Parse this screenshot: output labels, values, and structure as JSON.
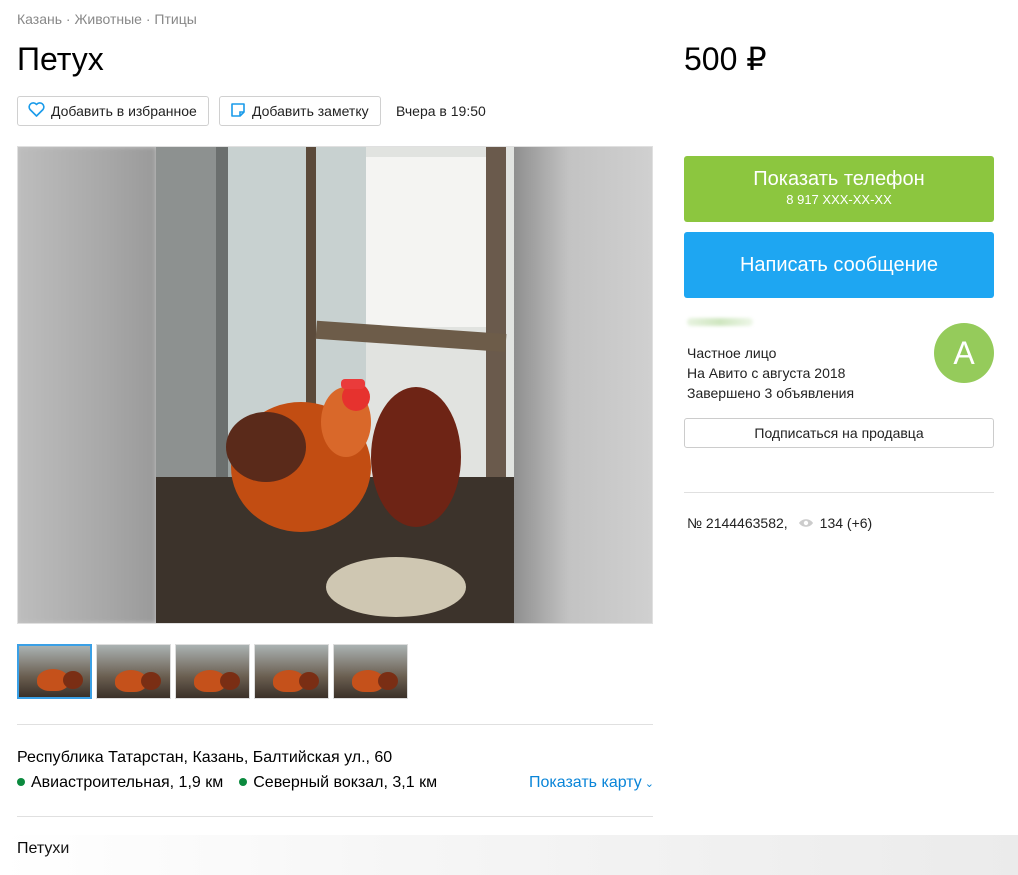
{
  "breadcrumb": [
    "Казань",
    "Животные",
    "Птицы"
  ],
  "breadcrumb_sep": "·",
  "title": "Петух",
  "price": "500 ₽",
  "actions": {
    "favorite_label": "Добавить в избранное",
    "note_label": "Добавить заметку",
    "posted": "Вчера в 19:50"
  },
  "contact": {
    "phone_label": "Показать телефон",
    "phone_masked": "8 917 XXX-XX-XX",
    "message_label": "Написать сообщение"
  },
  "seller": {
    "type": "Частное лицо",
    "since": "На Авито с августа 2018",
    "completed": "Завершено 3 объявления",
    "avatar_letter": "А",
    "subscribe_label": "Подписаться на продавца"
  },
  "ad": {
    "number": "№ 2144463582,",
    "views": "134 (+6)"
  },
  "location": {
    "address": "Республика Татарстан, Казань, Балтийская ул., 60",
    "metro": [
      {
        "name": "Авиастроительная, 1,9 км"
      },
      {
        "name": "Северный вокзал, 3,1 км"
      }
    ],
    "show_map_label": "Показать карту"
  },
  "description": "Петухи",
  "colors": {
    "phone_button": "#8cc63f",
    "message_button": "#1ea6f2",
    "link": "#0a85d8",
    "metro_dot": "#0b8a3e",
    "avatar": "#95cb5b"
  },
  "icons": {
    "favorite": "heart-icon",
    "note": "note-icon",
    "views": "eye-icon",
    "map": "chevron-down-icon"
  }
}
